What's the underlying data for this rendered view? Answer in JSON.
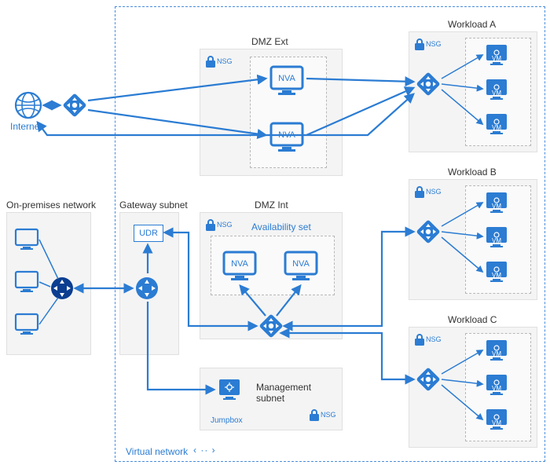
{
  "diagram": {
    "virtual_network_label": "Virtual network",
    "internet_label": "Internet",
    "onprem_label": "On-premises network",
    "gateway_subnet_label": "Gateway subnet",
    "dmz_ext_label": "DMZ Ext",
    "dmz_int_label": "DMZ Int",
    "availability_set_label": "Availability set",
    "mgmt_subnet_label": "Management subnet",
    "jumpbox_label": "Jumpbox",
    "udr_label": "UDR",
    "nsg_label": "NSG",
    "nva_label": "NVA",
    "vm_label": "VM",
    "workload_a_label": "Workload A",
    "workload_b_label": "Workload B",
    "workload_c_label": "Workload C",
    "resize_glyph": "‹ ·· ›"
  }
}
